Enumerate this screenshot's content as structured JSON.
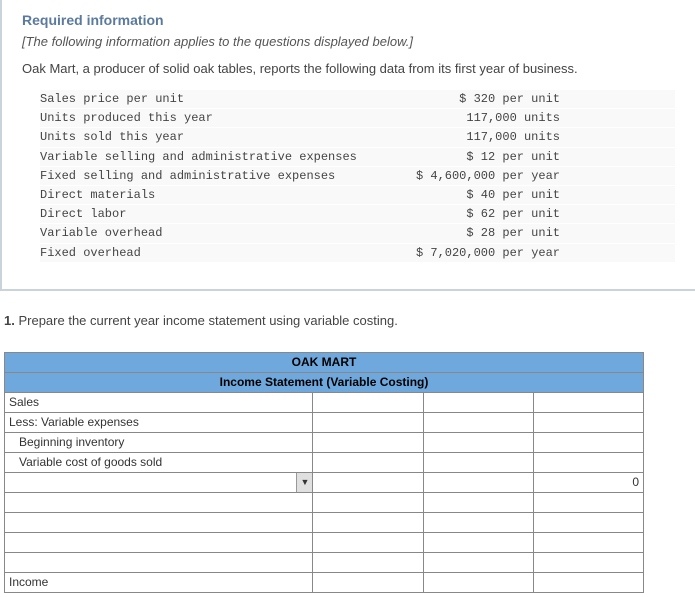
{
  "header": {
    "required": "Required information",
    "note": "[The following information applies to the questions displayed below.]",
    "intro": "Oak Mart, a producer of solid oak tables, reports the following data from its first year of business."
  },
  "data_rows": [
    {
      "label": "Sales price per unit",
      "value": "$ 320 per unit"
    },
    {
      "label": "Units produced this year",
      "value": "117,000 units"
    },
    {
      "label": "Units sold this year",
      "value": "117,000 units"
    },
    {
      "label": "Variable selling and administrative expenses",
      "value": "$ 12 per unit"
    },
    {
      "label": "Fixed selling and administrative expenses",
      "value": "$ 4,600,000 per year"
    },
    {
      "label": "Direct materials",
      "value": "$ 40 per unit"
    },
    {
      "label": "Direct labor",
      "value": "$ 62 per unit"
    },
    {
      "label": "Variable overhead",
      "value": "$ 28 per unit"
    },
    {
      "label": "Fixed overhead",
      "value": "$ 7,020,000 per year"
    }
  ],
  "question": {
    "num": "1.",
    "text": "Prepare the current year income statement using variable costing."
  },
  "table": {
    "title1": "OAK MART",
    "title2": "Income Statement (Variable Costing)",
    "rows": {
      "sales": "Sales",
      "less_var": "Less: Variable expenses",
      "beg_inv": "Beginning inventory",
      "var_cogs": "Variable cost of goods sold",
      "income": "Income"
    },
    "computed_zero": "0"
  }
}
